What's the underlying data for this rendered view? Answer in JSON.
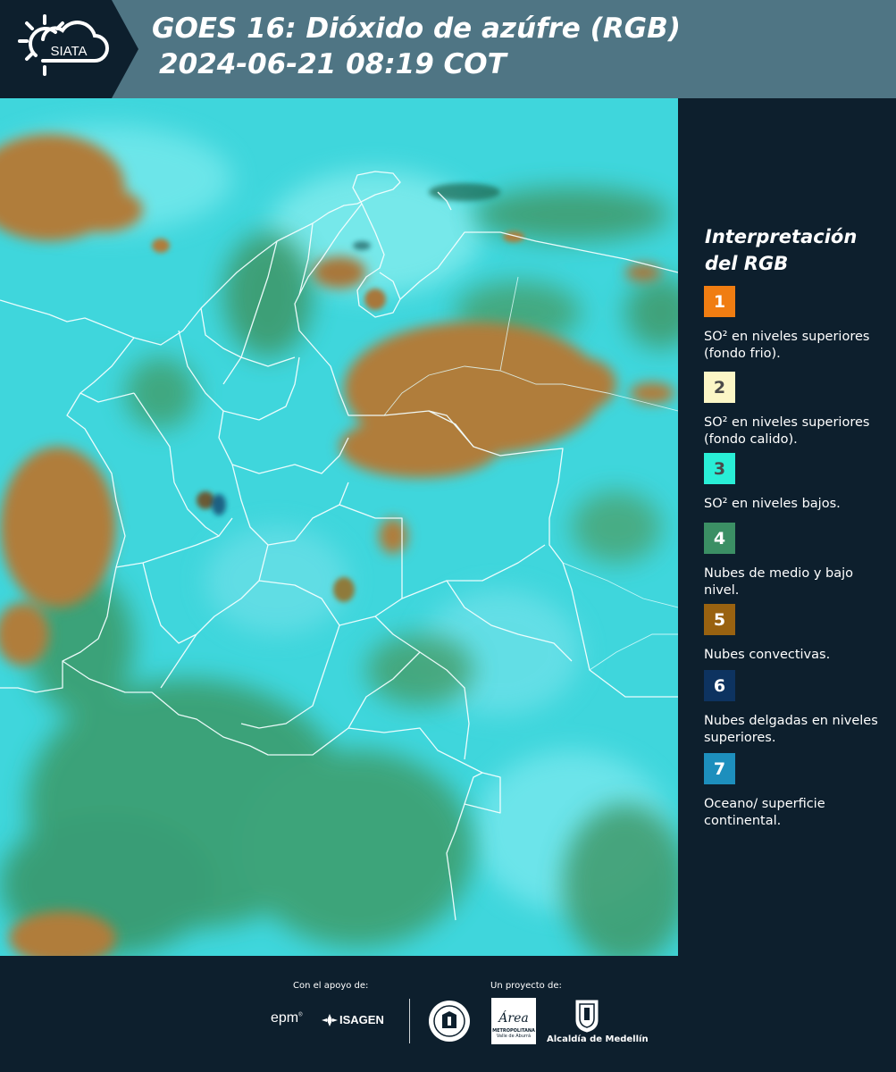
{
  "header": {
    "logo_text": "SIATA",
    "title_line1": "GOES 16: Dióxido de azúfre (RGB)",
    "title_line2": "2024-06-21 08:19 COT"
  },
  "legend": {
    "title_line1": "Interpretación",
    "title_line2": "del RGB",
    "items": [
      {
        "number": "1",
        "color": "#f07d12",
        "number_color": "#ffffff",
        "text": "SO² en niveles superiores (fondo frio)."
      },
      {
        "number": "2",
        "color": "#fbf6c6",
        "number_color": "#4a4a4a",
        "text": "SO² en niveles superiores (fondo calido)."
      },
      {
        "number": "3",
        "color": "#29eed6",
        "number_color": "#4a4a4a",
        "text": "SO² en niveles bajos."
      },
      {
        "number": "4",
        "color": "#3b8f64",
        "number_color": "#ffffff",
        "text": "Nubes de medio y bajo nivel."
      },
      {
        "number": "5",
        "color": "#996210",
        "number_color": "#ffffff",
        "text": "Nubes convectivas."
      },
      {
        "number": "6",
        "color": "#0d3360",
        "number_color": "#ffffff",
        "text": "Nubes delgadas en niveles superiores."
      },
      {
        "number": "7",
        "color": "#1d8fbd",
        "number_color": "#ffffff",
        "text": "Oceano/ superficie continental."
      }
    ]
  },
  "footer": {
    "support_caption": "Con el apoyo de:",
    "project_caption": "Un proyecto de:",
    "sponsor_epm": "epm",
    "sponsor_isagen": "ISAGEN",
    "sponsor_area_main": "Área",
    "sponsor_area_sub1": "METROPOLITANA",
    "sponsor_area_sub2": "Valle de Aburrá",
    "sponsor_alcaldia": "Alcaldía de Medellín"
  },
  "colors": {
    "header_bg": "#4f7584",
    "page_bg": "#0d1f2d",
    "ocean_cyan": "#3fd6dc",
    "land_green": "#3e9a6a",
    "convective_brown": "#b07d3a"
  }
}
